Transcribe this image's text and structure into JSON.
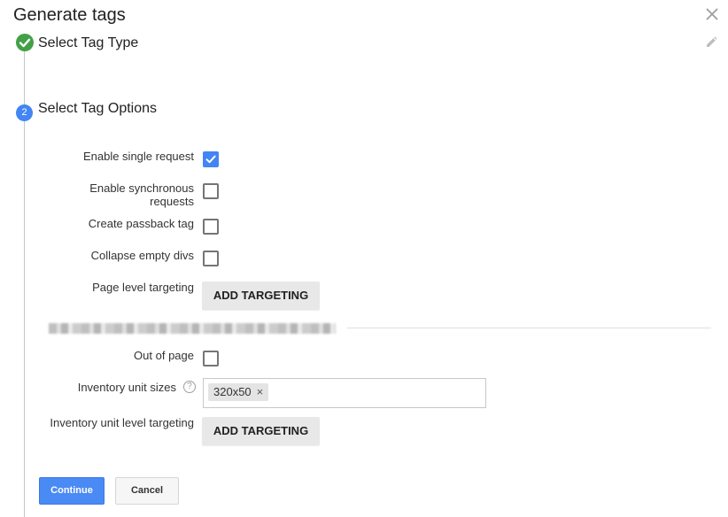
{
  "dialog": {
    "title": "Generate tags"
  },
  "icons": {
    "close": "close-icon",
    "edit": "pencil-icon",
    "step_done": "check-circle-icon",
    "help": "help-circle-icon"
  },
  "colors": {
    "accent": "#4285f4",
    "success": "#43a047",
    "primary_button": "#4a8af4"
  },
  "steps": [
    {
      "title": "Select Tag Type",
      "status": "complete"
    },
    {
      "number": "2",
      "title": "Select Tag Options",
      "status": "active"
    }
  ],
  "options": {
    "single_request": {
      "label": "Enable single request",
      "checked": true
    },
    "sync_requests": {
      "label_line1": "Enable synchronous",
      "label_line2": "requests",
      "checked": false
    },
    "passback": {
      "label": "Create passback tag",
      "checked": false
    },
    "collapse": {
      "label": "Collapse empty divs",
      "checked": false
    },
    "page_targeting": {
      "label": "Page level targeting",
      "button": "ADD TARGETING"
    }
  },
  "ad_unit": {
    "out_of_page": {
      "label": "Out of page",
      "checked": false
    },
    "sizes": {
      "label": "Inventory unit sizes",
      "help": "?",
      "chips": [
        "320x50"
      ],
      "remove_glyph": "×"
    },
    "unit_targeting": {
      "label": "Inventory unit level targeting",
      "button": "ADD TARGETING"
    }
  },
  "actions": {
    "continue": "Continue",
    "cancel": "Cancel"
  }
}
